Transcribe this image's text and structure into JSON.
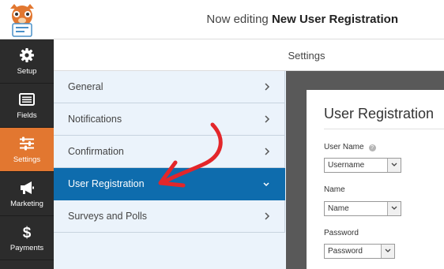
{
  "header": {
    "prefix": "Now editing",
    "form_name": "New User Registration"
  },
  "sidebar": {
    "items": [
      {
        "label": "Setup",
        "icon": "gear-icon",
        "active": false
      },
      {
        "label": "Fields",
        "icon": "list-icon",
        "active": false
      },
      {
        "label": "Settings",
        "icon": "sliders-icon",
        "active": true
      },
      {
        "label": "Marketing",
        "icon": "megaphone-icon",
        "active": false
      },
      {
        "label": "Payments",
        "icon": "dollar-icon",
        "active": false
      }
    ]
  },
  "settings": {
    "title": "Settings",
    "sections": [
      {
        "label": "General",
        "active": false
      },
      {
        "label": "Notifications",
        "active": false
      },
      {
        "label": "Confirmation",
        "active": false
      },
      {
        "label": "User Registration",
        "active": true
      },
      {
        "label": "Surveys and Polls",
        "active": false
      }
    ]
  },
  "preview": {
    "title": "User Registration",
    "fields": [
      {
        "label": "User Name",
        "value": "Username",
        "has_help": true
      },
      {
        "label": "Name",
        "value": "Name",
        "has_help": false
      },
      {
        "label": "Password",
        "value": "Password",
        "has_help": false
      }
    ]
  },
  "colors": {
    "sidebar_bg": "#2c2c2c",
    "sidebar_active": "#e27730",
    "section_active": "#0e6cad",
    "panel_bg": "#ebf3fb",
    "arrow": "#e3262a"
  }
}
